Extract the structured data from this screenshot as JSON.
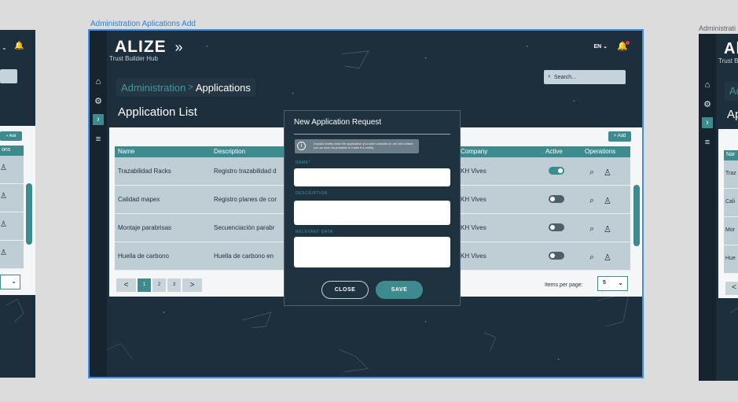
{
  "frame_label": "Administration Aplications Add",
  "brand": {
    "name": "ALIZE",
    "subtitle": "Trust Builder Hub",
    "chevrons": "»"
  },
  "header": {
    "language": "EN ⌄",
    "bell_icon": "bell-icon"
  },
  "search": {
    "placeholder": "Search..."
  },
  "breadcrumb": {
    "parent": "Administration",
    "separator": ">",
    "current": "Applications"
  },
  "page_title": "Application List",
  "table": {
    "add_label": "+ Add",
    "columns": [
      "Name",
      "Description",
      "Company",
      "Active",
      "Operations"
    ],
    "rows": [
      {
        "name": "Trazabilidad Racks",
        "description": "Registro trazabilidad d",
        "company": "KH Vives",
        "active": true
      },
      {
        "name": "Calidad mapex",
        "description": "Registro planes de cor",
        "company": "KH Vives",
        "active": false
      },
      {
        "name": "Montaje parabrisas",
        "description": "Secuenciación parabr",
        "company": "KH Vives",
        "active": false
      },
      {
        "name": "Huella de carbono",
        "description": "Huella de carbono en",
        "company": "KH Vives",
        "active": false
      }
    ]
  },
  "pagination": {
    "prev": "<",
    "pages": [
      "1",
      "2",
      "3"
    ],
    "current": "1",
    "next": ">"
  },
  "items_per_page": {
    "label": "Items per page:",
    "value": "5"
  },
  "modal": {
    "title": "New Application Request",
    "info": "Explain briefly what the application you want consists of, we will contact you as soon as possible to make it a reality.",
    "fields": [
      {
        "label": "NAME*",
        "value": ""
      },
      {
        "label": "DESCRIPTION",
        "value": ""
      },
      {
        "label": "RELEVANT DATA",
        "value": ""
      }
    ],
    "close_label": "CLOSE",
    "save_label": "SAVE"
  },
  "left_frame": {
    "language": "⌄",
    "add_label": "+ Add",
    "column_fragment": "ons",
    "select_chevron": "⌄"
  },
  "right_frame": {
    "label": "Administrati",
    "brand_fragment": "Al",
    "subtitle_fragment": "Trust B",
    "breadcrumb_fragment": "Ac",
    "title_fragment": "Ap",
    "column_fragment": "Nar",
    "row_fragments": [
      "Traz",
      "Cali",
      "Mor",
      "Hue"
    ],
    "pager_fragment": "<"
  },
  "colors": {
    "background": "#1d2e3c",
    "accent": "#3d8b8f",
    "selection": "#3a8ef0",
    "panel": "#f4f6f7",
    "row": "#bfcdd5"
  }
}
